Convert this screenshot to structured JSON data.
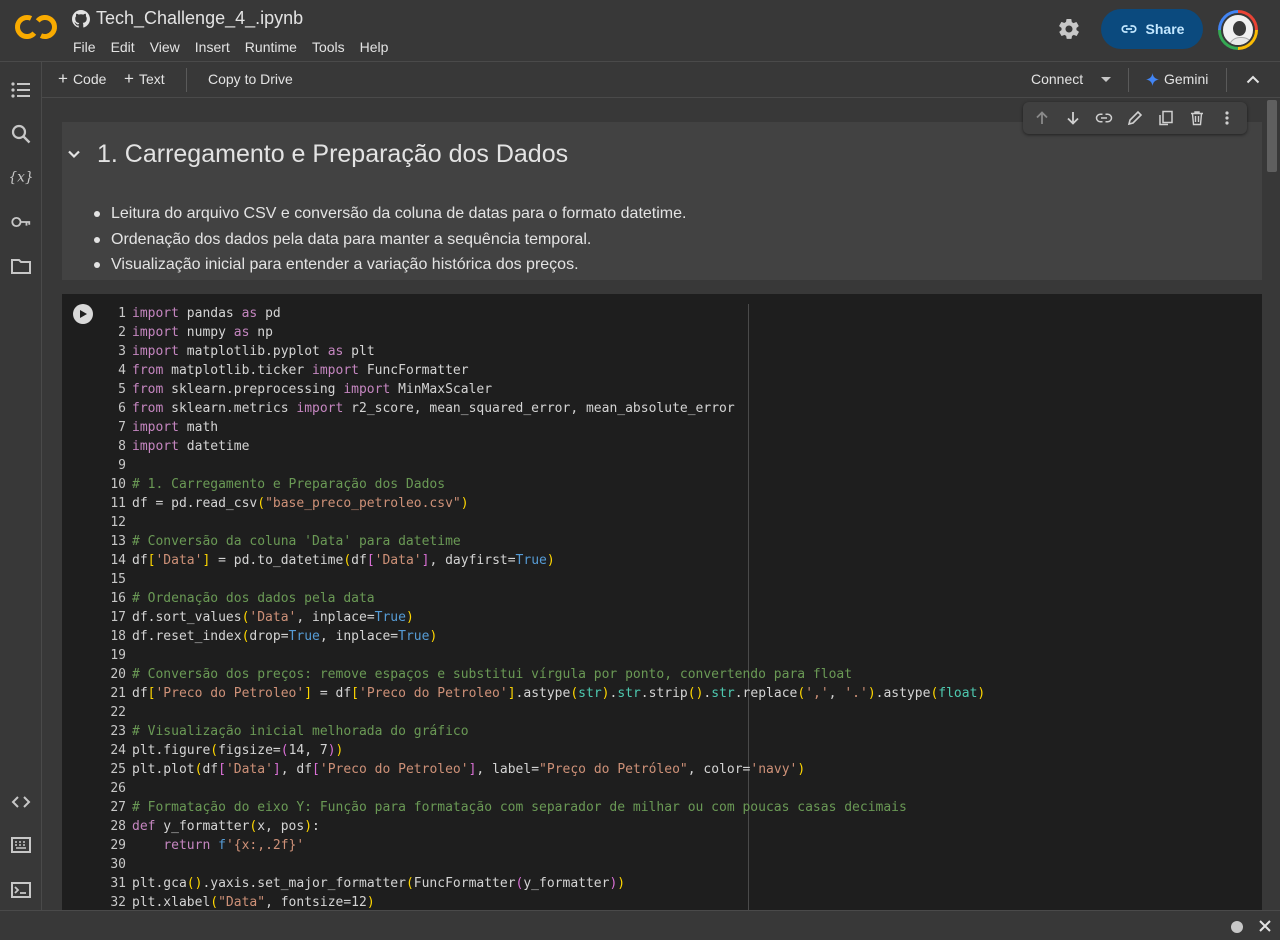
{
  "header": {
    "title": "Tech_Challenge_4_.ipynb",
    "menu": [
      "File",
      "Edit",
      "View",
      "Insert",
      "Runtime",
      "Tools",
      "Help"
    ],
    "share_label": "Share",
    "logo_text": "CO"
  },
  "toolbar": {
    "code_label": "Code",
    "text_label": "Text",
    "copy_label": "Copy to Drive",
    "connect_label": "Connect",
    "gemini_label": "Gemini"
  },
  "rail_icons": [
    "toc-icon",
    "search-icon",
    "variables-icon",
    "key-icon",
    "folder-icon",
    "code-snippets-icon",
    "command-palette-icon",
    "terminal-icon"
  ],
  "text_cell": {
    "heading": "1. Carregamento e Preparação dos Dados",
    "bullets": [
      "Leitura do arquivo CSV e conversão da coluna de datas para o formato datetime.",
      "Ordenação dos dados pela data para manter a sequência temporal.",
      "Visualização inicial para entender a variação histórica dos preços."
    ]
  },
  "cell_toolbar_icons": [
    "arrow-up-icon",
    "arrow-down-icon",
    "link-icon",
    "edit-icon",
    "mirror-cell-icon",
    "delete-icon",
    "more-icon"
  ],
  "code_cell": {
    "lines": [
      "import pandas as pd",
      "import numpy as np",
      "import matplotlib.pyplot as plt",
      "from matplotlib.ticker import FuncFormatter",
      "from sklearn.preprocessing import MinMaxScaler",
      "from sklearn.metrics import r2_score, mean_squared_error, mean_absolute_error",
      "import math",
      "import datetime",
      "",
      "# 1. Carregamento e Preparação dos Dados",
      "df = pd.read_csv(\"base_preco_petroleo.csv\")",
      "",
      "# Conversão da coluna 'Data' para datetime",
      "df['Data'] = pd.to_datetime(df['Data'], dayfirst=True)",
      "",
      "# Ordenação dos dados pela data",
      "df.sort_values('Data', inplace=True)",
      "df.reset_index(drop=True, inplace=True)",
      "",
      "# Conversão dos preços: remove espaços e substitui vírgula por ponto, convertendo para float",
      "df['Preco do Petroleo'] = df['Preco do Petroleo'].astype(str).str.strip().str.replace(',', '.').astype(float)",
      "",
      "# Visualização inicial melhorada do gráfico",
      "plt.figure(figsize=(14, 7))",
      "plt.plot(df['Data'], df['Preco do Petroleo'], label=\"Preço do Petróleo\", color='navy')",
      "",
      "# Formatação do eixo Y: Função para formatação com separador de milhar ou com poucas casas decimais",
      "def y_formatter(x, pos):",
      "    return f'{x:,.2f}'",
      "",
      "plt.gca().yaxis.set_major_formatter(FuncFormatter(y_formatter))",
      "plt.xlabel(\"Data\", fontsize=12)"
    ]
  },
  "colors": {
    "brand_orange": "#f9ab00",
    "share_bg": "#0b4a7e",
    "share_text": "#c2e7ff",
    "gemini_blue": "#4285f4"
  }
}
